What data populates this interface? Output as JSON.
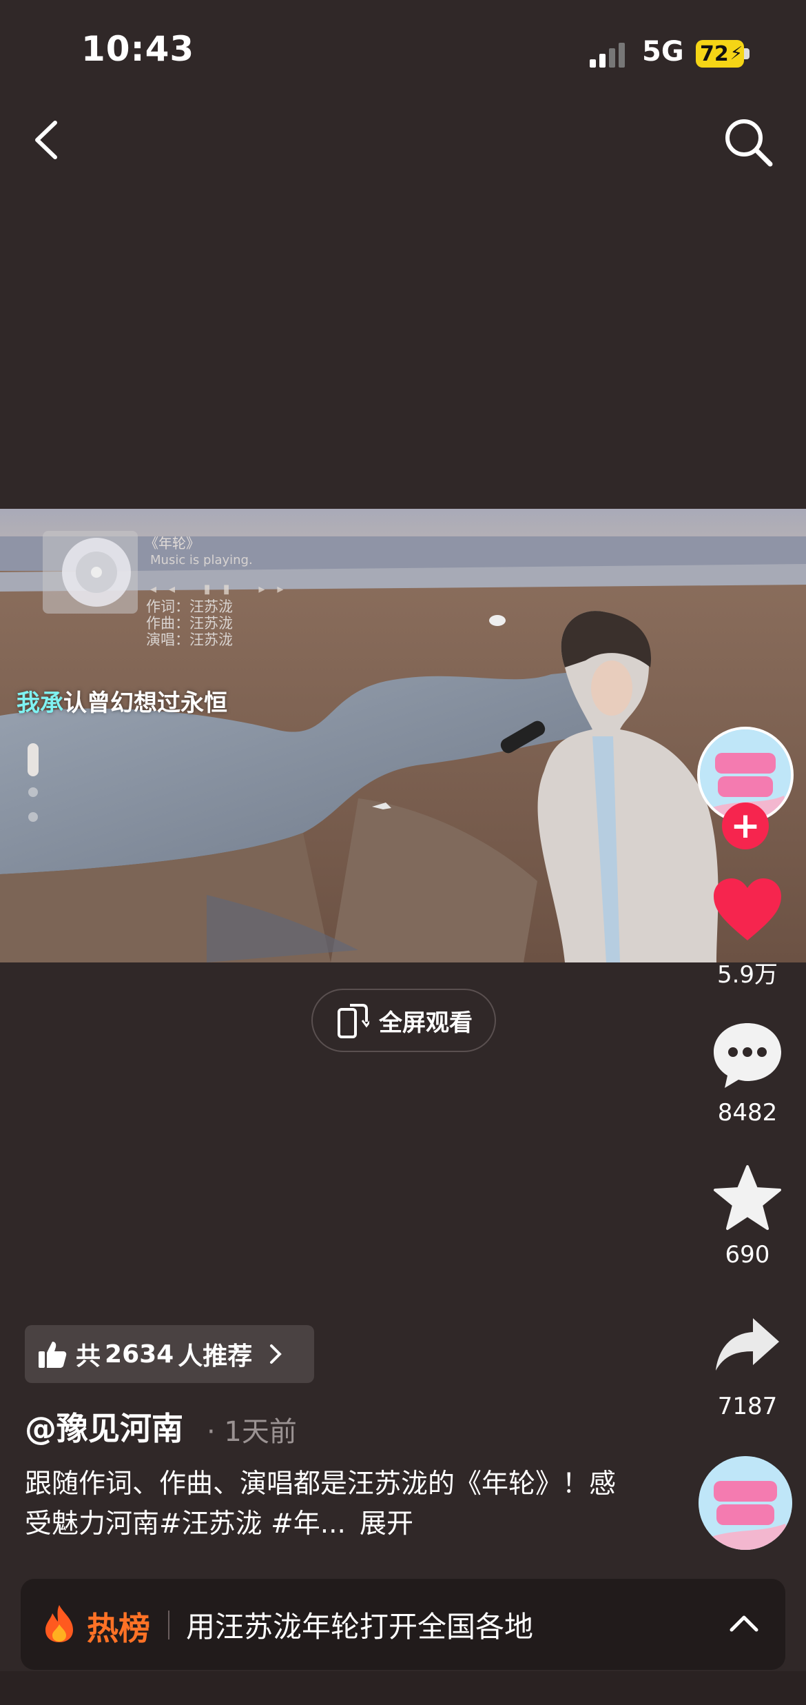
{
  "status_bar": {
    "time": "10:43",
    "network": "5G",
    "battery": "72"
  },
  "video": {
    "music_title": "《年轮》",
    "music_status": "Music is playing.",
    "credits": [
      "作词：汪苏泷",
      "作曲：汪苏泷",
      "演唱：汪苏泷"
    ],
    "lyric_highlight": "我承",
    "lyric_rest": "认曾幻想过永恒"
  },
  "fullscreen_label": "全屏观看",
  "rail": {
    "likes": "5.9万",
    "comments": "8482",
    "favorites": "690",
    "shares": "7187"
  },
  "colors": {
    "background": "#302828",
    "like": "#f6254e",
    "hot": "#ff7226",
    "lyric_highlight": "#7ff2f2"
  },
  "recommend": {
    "prefix": "共",
    "count": "2634",
    "suffix": "人推荐"
  },
  "post": {
    "author": "@豫见河南",
    "time_ago": "· 1天前",
    "description": "跟随作词、作曲、演唱都是汪苏泷的《年轮》！感受魅力河南#汪苏泷 #年...",
    "more_label": "展开"
  },
  "hot_bar": {
    "label": "热榜",
    "text": "用汪苏泷年轮打开全国各地"
  },
  "icons": [
    "back-chevron-icon",
    "search-icon",
    "heart-icon",
    "comment-icon",
    "star-icon",
    "share-icon",
    "thumbs-up-icon",
    "fullscreen-rotate-icon",
    "flame-icon",
    "chevron-up-icon"
  ]
}
